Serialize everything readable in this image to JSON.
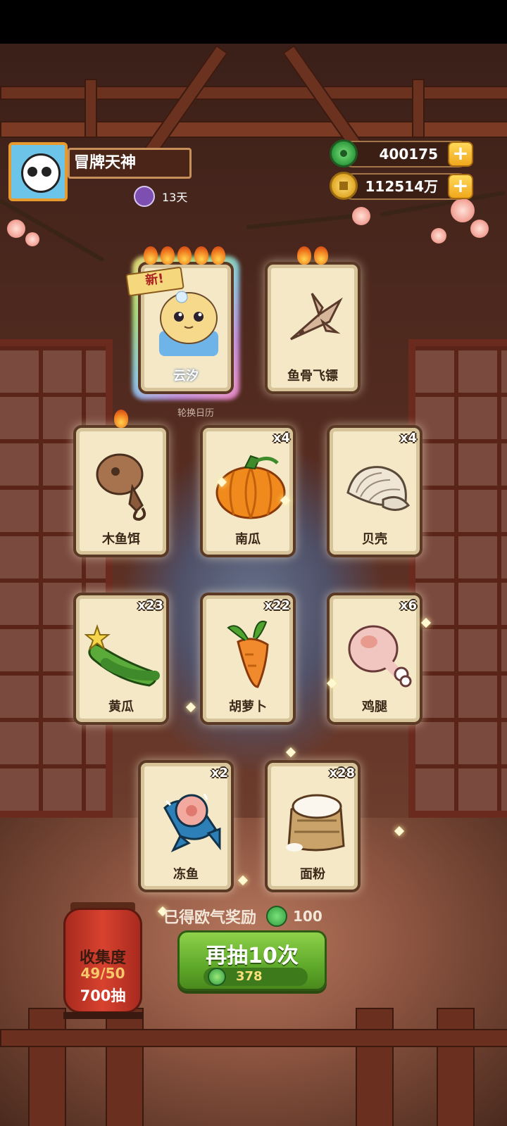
{
  "profile": {
    "name": "冒牌天神",
    "days": "13天"
  },
  "currency": {
    "jade": "400175",
    "coins": "112514万"
  },
  "rotation_label": "轮换日历",
  "featured_cards": [
    {
      "name": "云汐",
      "new_tag": "新!",
      "flames": 5
    },
    {
      "name": "鱼骨飞镖",
      "flames": 2
    }
  ],
  "cards": [
    {
      "name": "木鱼饵",
      "count": "",
      "flames": 1
    },
    {
      "name": "南瓜",
      "count": "x4"
    },
    {
      "name": "贝壳",
      "count": "x4"
    },
    {
      "name": "黄瓜",
      "count": "x23"
    },
    {
      "name": "胡萝卜",
      "count": "x22"
    },
    {
      "name": "鸡腿",
      "count": "x6"
    },
    {
      "name": "冻鱼",
      "count": "x2"
    },
    {
      "name": "面粉",
      "count": "x28"
    }
  ],
  "reward": {
    "label": "已得欧气奖励",
    "amount": "100"
  },
  "draw_button": {
    "label": "再抽10次",
    "cost": "378"
  },
  "collection": {
    "label": "收集度",
    "progress": "49/50",
    "draws": "700抽"
  },
  "colors": {
    "button_green": "#5fa92a",
    "card_bg": "#f4e8c7",
    "lantern_red": "#d8422f"
  }
}
